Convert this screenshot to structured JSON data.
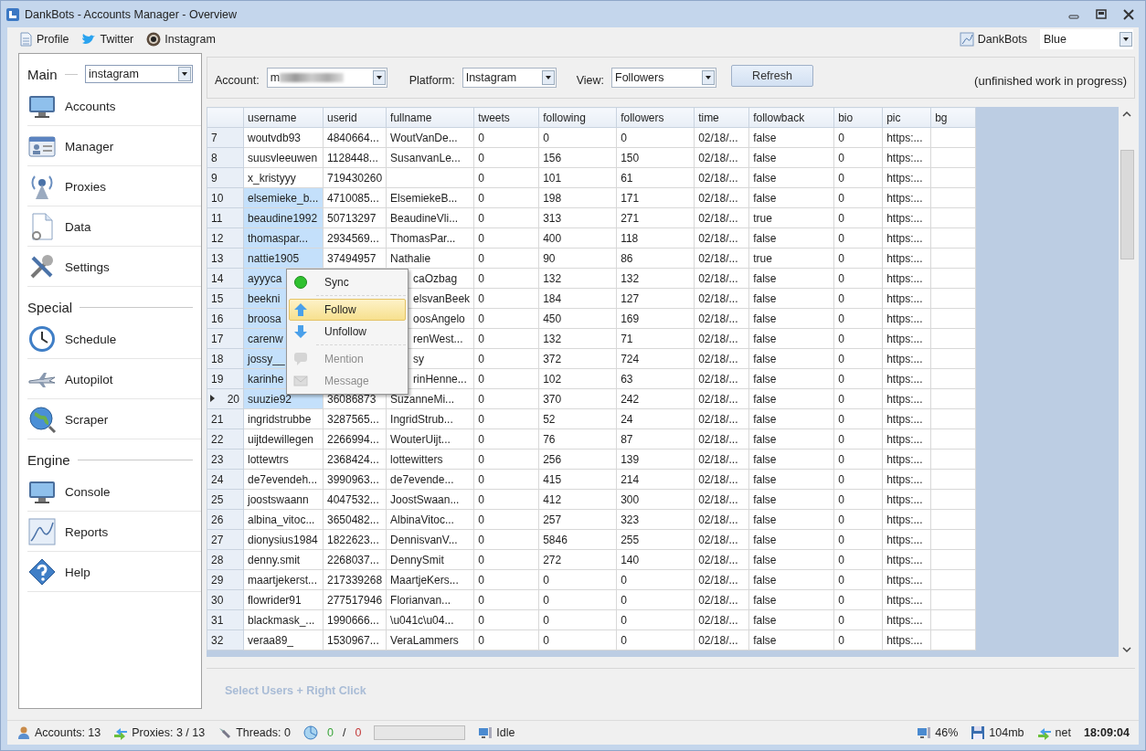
{
  "window": {
    "title": "DankBots - Accounts Manager - Overview"
  },
  "toolbar": {
    "links": [
      {
        "label": "Profile",
        "kind": "profile"
      },
      {
        "label": "Twitter",
        "kind": "twitter"
      },
      {
        "label": "Instagram",
        "kind": "instagram"
      }
    ],
    "brand": "DankBots",
    "theme": "Blue"
  },
  "sidebar": {
    "sections": [
      {
        "title": "Main",
        "dropdown": "instagram",
        "items": [
          {
            "label": "Accounts",
            "kind": "monitor"
          },
          {
            "label": "Manager",
            "kind": "card"
          },
          {
            "label": "Proxies",
            "kind": "antenna"
          },
          {
            "label": "Data",
            "kind": "document"
          },
          {
            "label": "Settings",
            "kind": "tools"
          }
        ]
      },
      {
        "title": "Special",
        "items": [
          {
            "label": "Schedule",
            "kind": "clock"
          },
          {
            "label": "Autopilot",
            "kind": "plane"
          },
          {
            "label": "Scraper",
            "kind": "globe"
          }
        ]
      },
      {
        "title": "Engine",
        "items": [
          {
            "label": "Console",
            "kind": "monitor"
          },
          {
            "label": "Reports",
            "kind": "chart"
          },
          {
            "label": "Help",
            "kind": "help"
          }
        ]
      }
    ]
  },
  "filters": {
    "account_label": "Account:",
    "account": "m",
    "platform_label": "Platform:",
    "platform": "Instagram",
    "view_label": "View:",
    "view": "Followers",
    "refresh": "Refresh",
    "note": "(unfinished work in progress)"
  },
  "table": {
    "columns": [
      "username",
      "userid",
      "fullname",
      "tweets",
      "following",
      "followers",
      "time",
      "followback",
      "bio",
      "pic",
      "bg"
    ],
    "rows": [
      {
        "index": "7",
        "selected": false,
        "current": false,
        "covered": false,
        "cells": [
          "woutvdb93",
          "4840664...",
          "WoutVanDe...",
          "0",
          "0",
          "0",
          "02/18/...",
          "false",
          "0",
          "https:...",
          ""
        ]
      },
      {
        "index": "8",
        "selected": false,
        "current": false,
        "covered": false,
        "cells": [
          "suusvleeuwen",
          "1128448...",
          "SusanvanLe...",
          "0",
          "156",
          "150",
          "02/18/...",
          "false",
          "0",
          "https:...",
          ""
        ]
      },
      {
        "index": "9",
        "selected": false,
        "current": false,
        "covered": false,
        "cells": [
          "x_kristyyy",
          "719430260",
          "",
          "0",
          "101",
          "61",
          "02/18/...",
          "false",
          "0",
          "https:...",
          ""
        ]
      },
      {
        "index": "10",
        "selected": true,
        "current": false,
        "covered": false,
        "cells": [
          "elsemieke_b...",
          "4710085...",
          "ElsemiekeB...",
          "0",
          "198",
          "171",
          "02/18/...",
          "false",
          "0",
          "https:...",
          ""
        ]
      },
      {
        "index": "11",
        "selected": true,
        "current": false,
        "covered": false,
        "cells": [
          "beaudine1992",
          "50713297",
          "BeaudineVli...",
          "0",
          "313",
          "271",
          "02/18/...",
          "true",
          "0",
          "https:...",
          ""
        ]
      },
      {
        "index": "12",
        "selected": true,
        "current": false,
        "covered": false,
        "cells": [
          "thomaspar...",
          "2934569...",
          "ThomasPar...",
          "0",
          "400",
          "118",
          "02/18/...",
          "false",
          "0",
          "https:...",
          ""
        ]
      },
      {
        "index": "13",
        "selected": true,
        "current": false,
        "covered": false,
        "cells": [
          "nattie1905",
          "37494957",
          "Nathalie",
          "0",
          "90",
          "86",
          "02/18/...",
          "true",
          "0",
          "https:...",
          ""
        ]
      },
      {
        "index": "14",
        "selected": true,
        "current": false,
        "covered": true,
        "cells": [
          "ayyyca",
          "",
          "caOzbag",
          "0",
          "132",
          "132",
          "02/18/...",
          "false",
          "0",
          "https:...",
          ""
        ]
      },
      {
        "index": "15",
        "selected": true,
        "current": false,
        "covered": true,
        "cells": [
          "beekni",
          "",
          "elsvanBeek",
          "0",
          "184",
          "127",
          "02/18/...",
          "false",
          "0",
          "https:...",
          ""
        ]
      },
      {
        "index": "16",
        "selected": true,
        "current": false,
        "covered": true,
        "cells": [
          "broosa",
          "",
          "oosAngelo",
          "0",
          "450",
          "169",
          "02/18/...",
          "false",
          "0",
          "https:...",
          ""
        ]
      },
      {
        "index": "17",
        "selected": true,
        "current": false,
        "covered": true,
        "cells": [
          "carenw",
          "",
          "renWest...",
          "0",
          "132",
          "71",
          "02/18/...",
          "false",
          "0",
          "https:...",
          ""
        ]
      },
      {
        "index": "18",
        "selected": true,
        "current": false,
        "covered": true,
        "cells": [
          "jossy__",
          "",
          "sy",
          "0",
          "372",
          "724",
          "02/18/...",
          "false",
          "0",
          "https:...",
          ""
        ]
      },
      {
        "index": "19",
        "selected": true,
        "current": false,
        "covered": true,
        "cells": [
          "karinhe",
          "",
          "rinHenne...",
          "0",
          "102",
          "63",
          "02/18/...",
          "false",
          "0",
          "https:...",
          ""
        ]
      },
      {
        "index": "20",
        "selected": true,
        "current": true,
        "covered": false,
        "cells": [
          "suuzie92",
          "36086873",
          "SuzanneMi...",
          "0",
          "370",
          "242",
          "02/18/...",
          "false",
          "0",
          "https:...",
          ""
        ]
      },
      {
        "index": "21",
        "selected": false,
        "current": false,
        "covered": false,
        "cells": [
          "ingridstrubbe",
          "3287565...",
          "IngridStrub...",
          "0",
          "52",
          "24",
          "02/18/...",
          "false",
          "0",
          "https:...",
          ""
        ]
      },
      {
        "index": "22",
        "selected": false,
        "current": false,
        "covered": false,
        "cells": [
          "uijtdewillegen",
          "2266994...",
          "WouterUijt...",
          "0",
          "76",
          "87",
          "02/18/...",
          "false",
          "0",
          "https:...",
          ""
        ]
      },
      {
        "index": "23",
        "selected": false,
        "current": false,
        "covered": false,
        "cells": [
          "lottewtrs",
          "2368424...",
          "lottewitters",
          "0",
          "256",
          "139",
          "02/18/...",
          "false",
          "0",
          "https:...",
          ""
        ]
      },
      {
        "index": "24",
        "selected": false,
        "current": false,
        "covered": false,
        "cells": [
          "de7evendeh...",
          "3990963...",
          "de7evende...",
          "0",
          "415",
          "214",
          "02/18/...",
          "false",
          "0",
          "https:...",
          ""
        ]
      },
      {
        "index": "25",
        "selected": false,
        "current": false,
        "covered": false,
        "cells": [
          "joostswaann",
          "4047532...",
          "JoostSwaan...",
          "0",
          "412",
          "300",
          "02/18/...",
          "false",
          "0",
          "https:...",
          ""
        ]
      },
      {
        "index": "26",
        "selected": false,
        "current": false,
        "covered": false,
        "cells": [
          "albina_vitoc...",
          "3650482...",
          "AlbinaVitoc...",
          "0",
          "257",
          "323",
          "02/18/...",
          "false",
          "0",
          "https:...",
          ""
        ]
      },
      {
        "index": "27",
        "selected": false,
        "current": false,
        "covered": false,
        "cells": [
          "dionysius1984",
          "1822623...",
          "DennisvanV...",
          "0",
          "5846",
          "255",
          "02/18/...",
          "false",
          "0",
          "https:...",
          ""
        ]
      },
      {
        "index": "28",
        "selected": false,
        "current": false,
        "covered": false,
        "cells": [
          "denny.smit",
          "2268037...",
          "DennySmit",
          "0",
          "272",
          "140",
          "02/18/...",
          "false",
          "0",
          "https:...",
          ""
        ]
      },
      {
        "index": "29",
        "selected": false,
        "current": false,
        "covered": false,
        "cells": [
          "maartjekerst...",
          "217339268",
          "MaartjeKers...",
          "0",
          "0",
          "0",
          "02/18/...",
          "false",
          "0",
          "https:...",
          ""
        ]
      },
      {
        "index": "30",
        "selected": false,
        "current": false,
        "covered": false,
        "cells": [
          "flowrider91",
          "277517946",
          "Florianvan...",
          "0",
          "0",
          "0",
          "02/18/...",
          "false",
          "0",
          "https:...",
          ""
        ]
      },
      {
        "index": "31",
        "selected": false,
        "current": false,
        "covered": false,
        "cells": [
          "blackmask_...",
          "1990666...",
          "\\u041c\\u04...",
          "0",
          "0",
          "0",
          "02/18/...",
          "false",
          "0",
          "https:...",
          ""
        ]
      },
      {
        "index": "32",
        "selected": false,
        "current": false,
        "covered": false,
        "cells": [
          "veraa89_",
          "1530967...",
          "VeraLammers",
          "0",
          "0",
          "0",
          "02/18/...",
          "false",
          "0",
          "https:...",
          ""
        ]
      }
    ]
  },
  "context_menu": {
    "items": [
      {
        "label": "Sync",
        "kind": "sync",
        "selected": false,
        "disabled": false,
        "separator_after": true
      },
      {
        "label": "Follow",
        "kind": "up",
        "selected": true,
        "disabled": false,
        "separator_after": false
      },
      {
        "label": "Unfollow",
        "kind": "down",
        "selected": false,
        "disabled": false,
        "separator_after": true
      },
      {
        "label": "Mention",
        "kind": "bubble",
        "selected": false,
        "disabled": true,
        "separator_after": false
      },
      {
        "label": "Message",
        "kind": "mail",
        "selected": false,
        "disabled": true,
        "separator_after": false
      }
    ]
  },
  "hint": "Select Users + Right Click",
  "status_bar": {
    "accounts": "Accounts: 13",
    "proxies": "Proxies: 3 / 13",
    "threads": "Threads: 0",
    "done": "0",
    "slash": "/",
    "failed": "0",
    "level": 0,
    "state": "Idle",
    "cpu": "46%",
    "memory": "104mb",
    "net": "net",
    "clock": "18:09:04"
  }
}
